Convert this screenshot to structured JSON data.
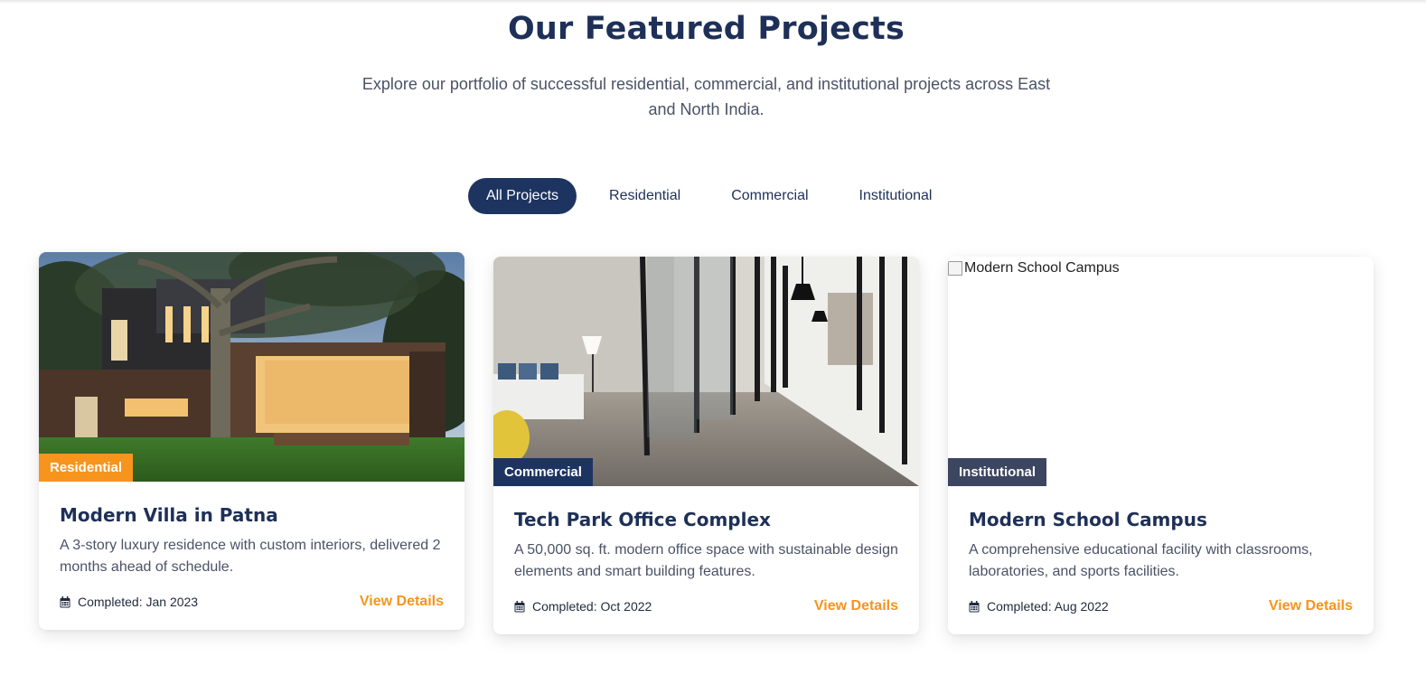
{
  "section": {
    "title": "Our Featured Projects",
    "subtitle": "Explore our portfolio of successful residential, commercial, and institutional projects across East and North India."
  },
  "filters": [
    "All Projects",
    "Residential",
    "Commercial",
    "Institutional"
  ],
  "active_filter": "All Projects",
  "colors": {
    "navy": "#1e3460",
    "orange": "#f7941d",
    "slate_badge": "#3d4660"
  },
  "projects": [
    {
      "category": "Residential",
      "title": "Modern Villa in Patna",
      "description": "A 3-story luxury residence with custom interiors, delivered 2 months ahead of schedule.",
      "completed": "Completed: Jan 2023",
      "cta": "View Details",
      "image_alt": "Modern Villa in Patna"
    },
    {
      "category": "Commercial",
      "title": "Tech Park Office Complex",
      "description": "A 50,000 sq. ft. modern office space with sustainable design elements and smart building features.",
      "completed": "Completed: Oct 2022",
      "cta": "View Details",
      "image_alt": "Tech Park Office Complex"
    },
    {
      "category": "Institutional",
      "title": "Modern School Campus",
      "description": "A comprehensive educational facility with classrooms, laboratories, and sports facilities.",
      "completed": "Completed: Aug 2022",
      "cta": "View Details",
      "image_alt": "Modern School Campus"
    }
  ],
  "icons": {
    "calendar": "calendar-icon",
    "broken_image": "broken-image-icon"
  }
}
